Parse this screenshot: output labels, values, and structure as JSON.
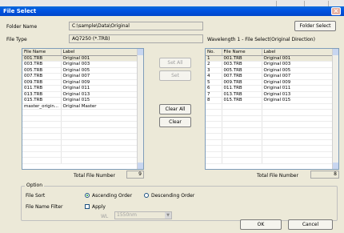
{
  "window": {
    "title": "File Select"
  },
  "folder": {
    "label": "Folder Name",
    "value": "C:\\sample\\Data\\Original",
    "button": "Folder Select"
  },
  "filetype": {
    "label": "File Type",
    "value": "AQ7250 (*.TRB)"
  },
  "right_header": "Wavelength 1 - File Select(Original Direction)",
  "left_list": {
    "columns": [
      "File Name",
      "Label"
    ],
    "rows": [
      [
        "001.TRB",
        "Original 001"
      ],
      [
        "003.TRB",
        "Original 003"
      ],
      [
        "005.TRB",
        "Original 005"
      ],
      [
        "007.TRB",
        "Original 007"
      ],
      [
        "009.TRB",
        "Original 009"
      ],
      [
        "011.TRB",
        "Original 011"
      ],
      [
        "013.TRB",
        "Original 013"
      ],
      [
        "015.TRB",
        "Original 015"
      ],
      [
        "master_origin...",
        "Original Master"
      ]
    ],
    "total_label": "Total File Number",
    "total_value": "9"
  },
  "right_list": {
    "columns": [
      "No.",
      "File Name",
      "Label"
    ],
    "rows": [
      [
        "1",
        "001.TRB",
        "Original 001"
      ],
      [
        "2",
        "003.TRB",
        "Original 003"
      ],
      [
        "3",
        "005.TRB",
        "Original 005"
      ],
      [
        "4",
        "007.TRB",
        "Original 007"
      ],
      [
        "5",
        "009.TRB",
        "Original 009"
      ],
      [
        "6",
        "011.TRB",
        "Original 011"
      ],
      [
        "7",
        "013.TRB",
        "Original 013"
      ],
      [
        "8",
        "015.TRB",
        "Original 015"
      ]
    ],
    "total_label": "Total File Number",
    "total_value": "8"
  },
  "middle_buttons": {
    "set_all": "Set All",
    "set": "Set",
    "clear_all": "Clear All",
    "clear": "Clear"
  },
  "option": {
    "title": "Option",
    "sort_label": "File Sort",
    "ascending": "Ascending Order",
    "descending": "Descending Order",
    "filter_label": "File Name Filter",
    "apply": "Apply",
    "wl_label": "WL",
    "wl_value": "1550nm"
  },
  "footer": {
    "ok": "OK",
    "cancel": "Cancel"
  }
}
